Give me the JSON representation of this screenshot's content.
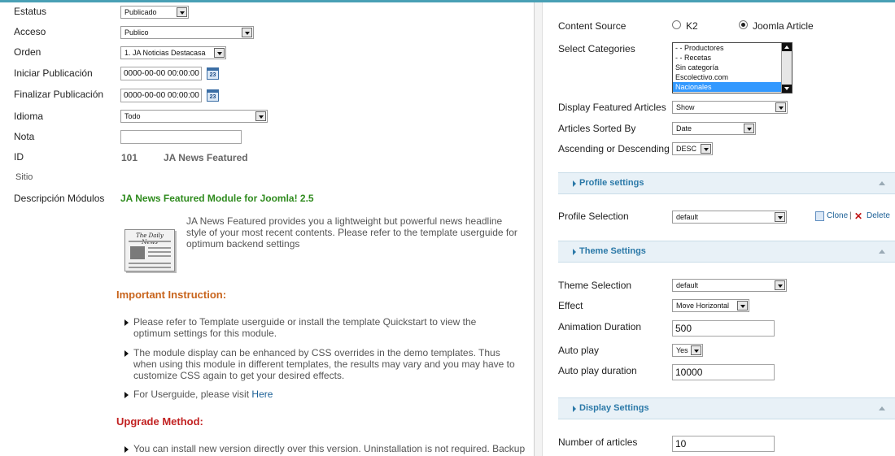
{
  "left": {
    "fields": {
      "estatus": {
        "label": "Estatus",
        "value": "Publicado"
      },
      "acceso": {
        "label": "Acceso",
        "value": "Publico"
      },
      "orden": {
        "label": "Orden",
        "value": "1. JA Noticias Destacasa"
      },
      "iniciar": {
        "label": "Iniciar Publicación",
        "value": "0000-00-00 00:00:00"
      },
      "finalizar": {
        "label": "Finalizar Publicación",
        "value": "0000-00-00 00:00:00"
      },
      "idioma": {
        "label": "Idioma",
        "value": "Todo"
      },
      "nota": {
        "label": "Nota",
        "value": ""
      },
      "id": {
        "label": "ID",
        "number": "101",
        "name": "JA News Featured"
      },
      "sitio": {
        "label": "Sitio"
      },
      "descripcion": {
        "label": "Descripción Módulos"
      }
    },
    "calendar_icon_text": "23",
    "module_title": "JA News Featured Module for Joomla! 2.5",
    "module_description": "JA News Featured provides you a lightweight but powerful news headline style of your most recent contents. Please refer to the template userguide for optimum backend settings",
    "newspaper_masthead": "The Daily News",
    "important_heading": "Important Instruction:",
    "instructions": [
      "Please refer to Template userguide or install the template Quickstart to view the optimum settings for this module.",
      "The module display can be enhanced by CSS overrides in the demo templates. Thus when using this module in different templates, the results may vary and you may have to customize CSS again to get your desired effects.",
      "For Userguide, please visit "
    ],
    "here_link": "Here",
    "upgrade_heading": "Upgrade Method:",
    "upgrade_items": [
      "You can install new version directly over this version. Uninstallation is not required. Backup"
    ]
  },
  "right": {
    "content_source": {
      "label": "Content Source",
      "options": [
        "K2",
        "Joomla Article"
      ],
      "selected": "Joomla Article"
    },
    "select_categories": {
      "label": "Select Categories",
      "options": [
        "- - Productores",
        "- - Recetas",
        "Sin categoría",
        "Escolectivo.com",
        "Nacionales"
      ],
      "selected": "Nacionales"
    },
    "display_featured": {
      "label": "Display Featured Articles",
      "value": "Show"
    },
    "sorted_by": {
      "label": "Articles Sorted By",
      "value": "Date"
    },
    "asc_desc": {
      "label": "Ascending or Descending",
      "value": "DESC"
    },
    "profile_section": "Profile settings",
    "profile_selection": {
      "label": "Profile Selection",
      "value": "default"
    },
    "clone_label": "Clone",
    "separator": "|",
    "delete_label": "Delete",
    "theme_section": "Theme Settings",
    "theme_selection": {
      "label": "Theme Selection",
      "value": "default"
    },
    "effect": {
      "label": "Effect",
      "value": "Move Horizontal"
    },
    "animation_duration": {
      "label": "Animation Duration",
      "value": "500"
    },
    "auto_play": {
      "label": "Auto play",
      "value": "Yes"
    },
    "auto_play_duration": {
      "label": "Auto play duration",
      "value": "10000"
    },
    "display_section": "Display Settings",
    "number_of_articles": {
      "label": "Number of articles",
      "value": "10"
    }
  },
  "colors": {
    "accent_top": "#49a0b5",
    "section_bg": "#e8f1f7",
    "section_text": "#2b79a8",
    "title_green": "#2f8b1e",
    "instruction_orange": "#c8641c",
    "upgrade_red": "#c22222",
    "link_blue": "#1a5f96"
  },
  "icons": [
    "calendar-icon",
    "newspaper-icon",
    "clone-icon",
    "delete-icon",
    "dropdown-arrow-icon",
    "triangle-right-icon",
    "collapse-caret-icon"
  ]
}
